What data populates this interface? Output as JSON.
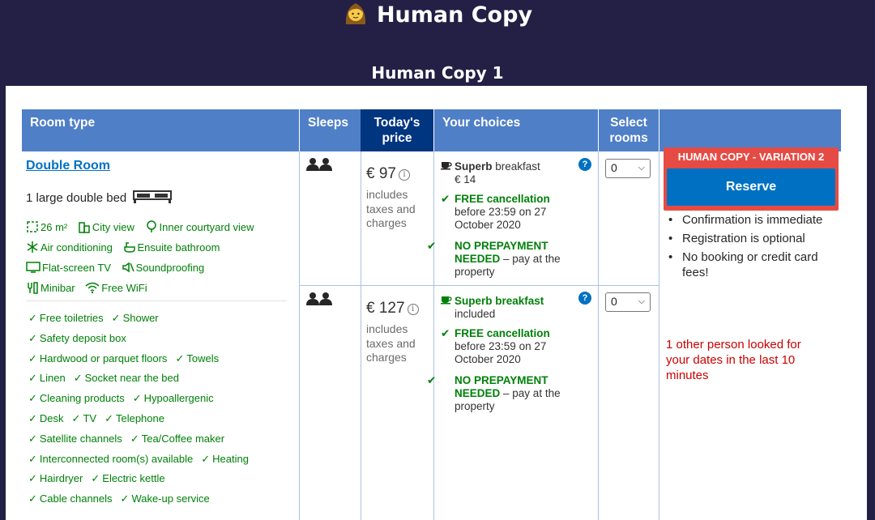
{
  "app": {
    "title": "Human Copy"
  },
  "copy": {
    "title": "Human Copy 1"
  },
  "table": {
    "headers": {
      "room_type": "Room type",
      "sleeps": "Sleeps",
      "price": "Today's price",
      "choices": "Your choices",
      "select": "Select rooms"
    }
  },
  "room": {
    "name": "Double Room",
    "bed": "1 large double bed",
    "facilities": {
      "size": "26 m²",
      "city_view": "City view",
      "courtyard_view": "Inner courtyard view",
      "air_conditioning": "Air conditioning",
      "ensuite": "Ensuite bathroom",
      "tv": "Flat-screen TV",
      "soundproofing": "Soundproofing",
      "minibar": "Minibar",
      "wifi": "Free WiFi"
    },
    "amenities": [
      [
        "Free toiletries",
        "Shower"
      ],
      [
        "Safety deposit box"
      ],
      [
        "Hardwood or parquet floors",
        "Towels"
      ],
      [
        "Linen",
        "Socket near the bed"
      ],
      [
        "Cleaning products",
        "Hypoallergenic"
      ],
      [
        "Desk",
        "TV",
        "Telephone"
      ],
      [
        "Satellite channels",
        "Tea/Coffee maker"
      ],
      [
        "Interconnected room(s) available",
        "Heating"
      ],
      [
        "Hairdryer",
        "Electric kettle"
      ],
      [
        "Cable channels",
        "Wake-up service"
      ]
    ]
  },
  "options": [
    {
      "price": "€ 97",
      "price_note": "includes taxes and charges",
      "breakfast_title": "Superb",
      "breakfast_rest": "breakfast",
      "breakfast_sub": "€ 14",
      "cancel_title": "FREE cancellation",
      "cancel_sub": "before 23:59 on 27 October 2020",
      "prepay_title": "NO PREPAYMENT NEEDED",
      "prepay_sub": "– pay at the property",
      "quantity": "0"
    },
    {
      "price": "€ 127",
      "price_note": "includes taxes and charges",
      "breakfast_title": "Superb breakfast",
      "breakfast_rest": "",
      "breakfast_sub": "included",
      "cancel_title": "FREE cancellation",
      "cancel_sub": "before 23:59 on 27 October 2020",
      "prepay_title": "NO PREPAYMENT NEEDED",
      "prepay_sub": "– pay at the property",
      "quantity": "0"
    }
  ],
  "reserve": {
    "variation_label": "HUMAN COPY - VARIATION 2",
    "button": "Reserve",
    "bullets": [
      "Confirmation is immediate",
      "Registration is optional",
      "No booking or credit card fees!"
    ],
    "looked": "1 other person looked for your dates in the last 10 minutes"
  },
  "colors": {
    "background": "#241f45",
    "header": "#4f7fc7",
    "header_dark": "#003580",
    "link": "#0071c2",
    "green": "#008009",
    "variation": "#e54b44",
    "warning": "#cc0000"
  },
  "icons": [
    "woman-emoji-icon",
    "bed-icon",
    "size-icon",
    "building-icon",
    "tree-icon",
    "snowflake-icon",
    "bath-icon",
    "tv-icon",
    "soundproof-icon",
    "minibar-icon",
    "wifi-icon",
    "check-icon",
    "people-icon",
    "coffee-icon",
    "help-icon",
    "chevron-down-icon",
    "info-icon"
  ]
}
